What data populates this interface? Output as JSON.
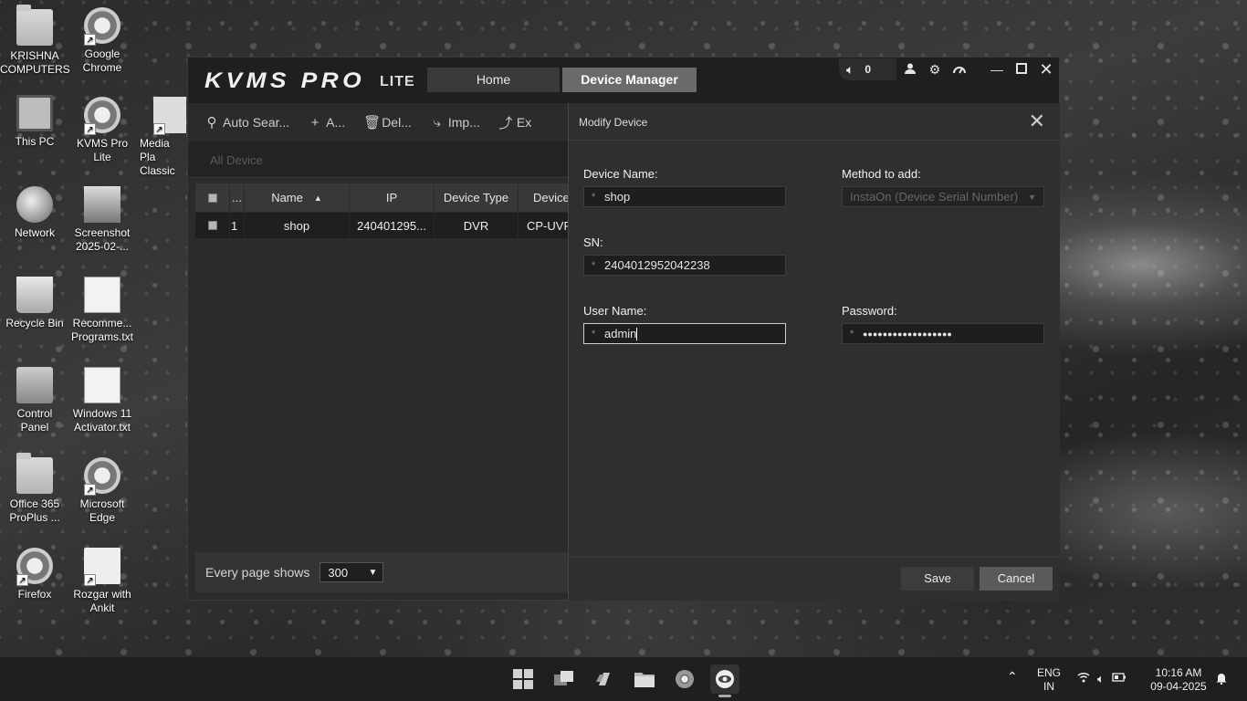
{
  "desktop": {
    "icons": [
      {
        "label": "KRISHNA\nCOMPUTERS",
        "icon": "folder-icon"
      },
      {
        "label": "Google\nChrome",
        "icon": "chrome-icon"
      },
      {
        "label": "This PC",
        "icon": "monitor-icon"
      },
      {
        "label": "KVMS Pro\nLite",
        "icon": "kvms-icon"
      },
      {
        "label": "Media Pla\nClassic",
        "icon": "media-player-icon"
      },
      {
        "label": "Network",
        "icon": "network-icon"
      },
      {
        "label": "Screenshot\n2025-02-...",
        "icon": "image-icon"
      },
      {
        "label": "Recycle Bin",
        "icon": "recycle-bin-icon"
      },
      {
        "label": "Recomme...\nPrograms.txt",
        "icon": "text-file-icon"
      },
      {
        "label": "Control\nPanel",
        "icon": "control-panel-icon"
      },
      {
        "label": "Windows 11\nActivator.txt",
        "icon": "text-file-icon"
      },
      {
        "label": "Office 365\nProPlus ...",
        "icon": "folder-icon"
      },
      {
        "label": "Microsoft\nEdge",
        "icon": "edge-icon"
      },
      {
        "label": "Firefox",
        "icon": "firefox-icon"
      },
      {
        "label": "Rozgar with\nAnkit",
        "icon": "rozgar-icon"
      }
    ]
  },
  "app": {
    "logo": "KVMS PRO",
    "logo_suffix": "LITE",
    "tabs": {
      "home": "Home",
      "device_manager": "Device Manager"
    },
    "alarm_count": "0",
    "toolbar": {
      "auto_search": "Auto Sear...",
      "add": "A...",
      "delete": "Del...",
      "import": "Imp...",
      "export": "Ex"
    },
    "subtab": "All Device",
    "grid": {
      "headers": {
        "check": "...",
        "name": "Name",
        "ip": "IP",
        "type": "Device Type",
        "device": "Device"
      },
      "rows": [
        {
          "index": "1",
          "name": "shop",
          "ip": "240401295...",
          "type": "DVR",
          "device": "CP-UVR"
        }
      ]
    },
    "footer": {
      "label": "Every page shows",
      "page_size": "300"
    }
  },
  "modal": {
    "title": "Modify Device",
    "device_name_label": "Device Name:",
    "device_name": "shop",
    "method_label": "Method to add:",
    "method": "InstaOn (Device Serial Number)",
    "sn_label": "SN:",
    "sn": "2404012952042238",
    "username_label": "User Name:",
    "username": "admin",
    "password_label": "Password:",
    "password": "●●●●●●●●●●●●●●●●●●",
    "required_mark": "*",
    "save": "Save",
    "cancel": "Cancel"
  },
  "taskbar": {
    "lang": "ENG",
    "region": "IN",
    "time": "10:16 AM",
    "date": "09-04-2025"
  }
}
